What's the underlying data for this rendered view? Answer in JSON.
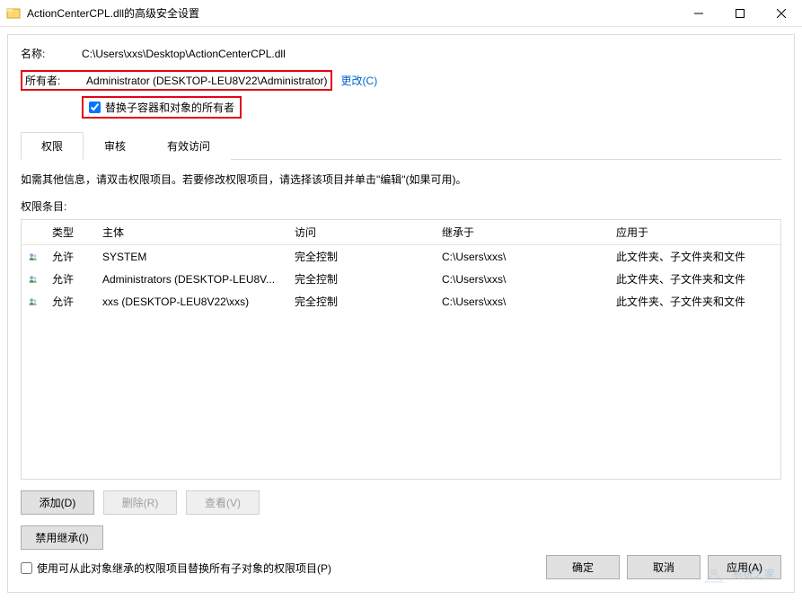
{
  "titlebar": {
    "title": "ActionCenterCPL.dll的高级安全设置"
  },
  "fields": {
    "name_label": "名称:",
    "name_value": "C:\\Users\\xxs\\Desktop\\ActionCenterCPL.dll",
    "owner_label": "所有者:",
    "owner_value": "Administrator (DESKTOP-LEU8V22\\Administrator)",
    "change_link": "更改(C)",
    "replace_owner_label": "替换子容器和对象的所有者"
  },
  "tabs": {
    "items": [
      {
        "label": "权限",
        "active": true
      },
      {
        "label": "审核",
        "active": false
      },
      {
        "label": "有效访问",
        "active": false
      }
    ]
  },
  "instructions": "如需其他信息，请双击权限项目。若要修改权限项目，请选择该项目并单击\"编辑\"(如果可用)。",
  "perm_section_label": "权限条目:",
  "perm_headers": {
    "type": "类型",
    "principal": "主体",
    "access": "访问",
    "inherit": "继承于",
    "applies": "应用于"
  },
  "perm_rows": [
    {
      "type": "允许",
      "principal": "SYSTEM",
      "access": "完全控制",
      "inherit": "C:\\Users\\xxs\\",
      "applies": "此文件夹、子文件夹和文件"
    },
    {
      "type": "允许",
      "principal": "Administrators (DESKTOP-LEU8V...",
      "access": "完全控制",
      "inherit": "C:\\Users\\xxs\\",
      "applies": "此文件夹、子文件夹和文件"
    },
    {
      "type": "允许",
      "principal": "xxs (DESKTOP-LEU8V22\\xxs)",
      "access": "完全控制",
      "inherit": "C:\\Users\\xxs\\",
      "applies": "此文件夹、子文件夹和文件"
    }
  ],
  "buttons": {
    "add": "添加(D)",
    "remove": "删除(R)",
    "view": "查看(V)",
    "disable_inherit": "禁用继承(I)",
    "replace_child": "使用可从此对象继承的权限项目替换所有子对象的权限项目(P)",
    "ok": "确定",
    "cancel": "取消",
    "apply": "应用(A)"
  },
  "watermark": "系统之家"
}
